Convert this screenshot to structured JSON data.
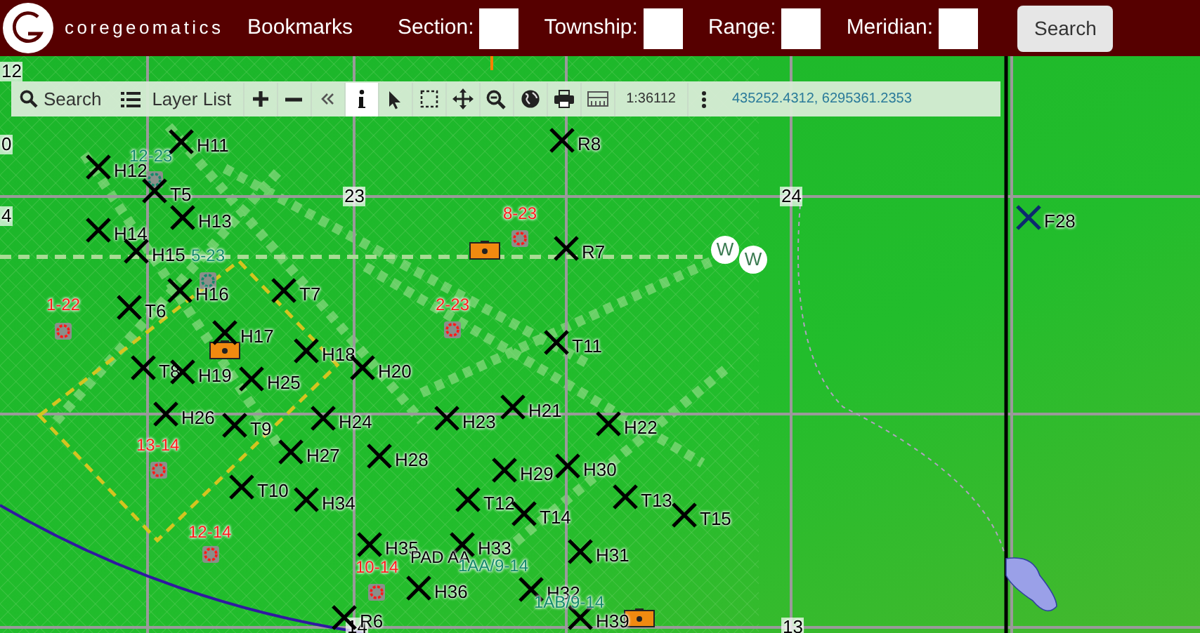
{
  "header": {
    "brand": "coregeomatics",
    "bookmarks": "Bookmarks",
    "fields": [
      {
        "label": "Section:"
      },
      {
        "label": "Township:"
      },
      {
        "label": "Range:"
      },
      {
        "label": "Meridian:"
      }
    ],
    "search_button": "Search"
  },
  "toolbar": {
    "search": "Search",
    "layer_list": "Layer List",
    "tools": [
      {
        "kind": "zoom-in",
        "selected": false
      },
      {
        "kind": "zoom-out",
        "selected": false
      },
      {
        "kind": "collapse",
        "selected": false
      },
      {
        "kind": "info",
        "selected": true
      },
      {
        "kind": "pointer",
        "selected": false
      },
      {
        "kind": "box-select",
        "selected": false
      },
      {
        "kind": "pan",
        "selected": false
      },
      {
        "kind": "zoom-area",
        "selected": false
      },
      {
        "kind": "globe",
        "selected": false
      },
      {
        "kind": "print",
        "selected": false
      },
      {
        "kind": "measure",
        "selected": false
      }
    ],
    "scale": "1:36112",
    "coordinates": "435252.4312, 6295361.2353"
  },
  "map": {
    "section_numbers": [
      "12",
      "0",
      "4",
      "23",
      "24",
      "13",
      "14"
    ],
    "wells": [
      {
        "label": "H11",
        "color": "#000000"
      },
      {
        "label": "H12",
        "color": "#000000"
      },
      {
        "label": "T5",
        "color": "#000000"
      },
      {
        "label": "H13",
        "color": "#000000"
      },
      {
        "label": "H14",
        "color": "#000000"
      },
      {
        "label": "H15",
        "color": "#000000"
      },
      {
        "label": "H16",
        "color": "#000000"
      },
      {
        "label": "T6",
        "color": "#000000"
      },
      {
        "label": "T7",
        "color": "#000000"
      },
      {
        "label": "H17",
        "color": "#000000"
      },
      {
        "label": "H18",
        "color": "#000000"
      },
      {
        "label": "T8",
        "color": "#000000"
      },
      {
        "label": "H19",
        "color": "#000000"
      },
      {
        "label": "H25",
        "color": "#000000"
      },
      {
        "label": "H20",
        "color": "#000000"
      },
      {
        "label": "R8",
        "color": "#000000"
      },
      {
        "label": "R7",
        "color": "#000000"
      },
      {
        "label": "T11",
        "color": "#000000"
      },
      {
        "label": "F28",
        "color": "#0c2a6e"
      },
      {
        "label": "H26",
        "color": "#000000"
      },
      {
        "label": "T9",
        "color": "#000000"
      },
      {
        "label": "H24",
        "color": "#000000"
      },
      {
        "label": "H23",
        "color": "#000000"
      },
      {
        "label": "H21",
        "color": "#000000"
      },
      {
        "label": "H22",
        "color": "#000000"
      },
      {
        "label": "H27",
        "color": "#000000"
      },
      {
        "label": "H28",
        "color": "#000000"
      },
      {
        "label": "H29",
        "color": "#000000"
      },
      {
        "label": "H30",
        "color": "#000000"
      },
      {
        "label": "T10",
        "color": "#000000"
      },
      {
        "label": "H34",
        "color": "#000000"
      },
      {
        "label": "T12",
        "color": "#000000"
      },
      {
        "label": "T14",
        "color": "#000000"
      },
      {
        "label": "T13",
        "color": "#000000"
      },
      {
        "label": "T15",
        "color": "#000000"
      },
      {
        "label": "H35",
        "color": "#000000"
      },
      {
        "label": "H33",
        "color": "#000000"
      },
      {
        "label": "H31",
        "color": "#000000"
      },
      {
        "label": "H36",
        "color": "#000000"
      },
      {
        "label": "H32",
        "color": "#000000"
      },
      {
        "label": "H39",
        "color": "#000000"
      },
      {
        "label": "R6",
        "color": "#000000"
      }
    ],
    "sites": [
      {
        "label": "12-23",
        "color": "#138a6a"
      },
      {
        "label": "5-23",
        "color": "#138a6a"
      },
      {
        "label": "8-23",
        "color": "#ff1a1a"
      },
      {
        "label": "2-23",
        "color": "#ff1a1a"
      },
      {
        "label": "1-22",
        "color": "#ff1a1a"
      },
      {
        "label": "13-14",
        "color": "#ff1a1a"
      },
      {
        "label": "12-14",
        "color": "#ff1a1a"
      },
      {
        "label": "10-14",
        "color": "#ff1a1a"
      }
    ],
    "pad_labels": [
      {
        "label": "PAD AA",
        "color": "#000000"
      },
      {
        "label": "1AA/9-14",
        "color": "#138a6a"
      },
      {
        "label": "1AB/9-14",
        "color": "#138a6a"
      }
    ],
    "markers": [
      "W",
      "W"
    ]
  }
}
